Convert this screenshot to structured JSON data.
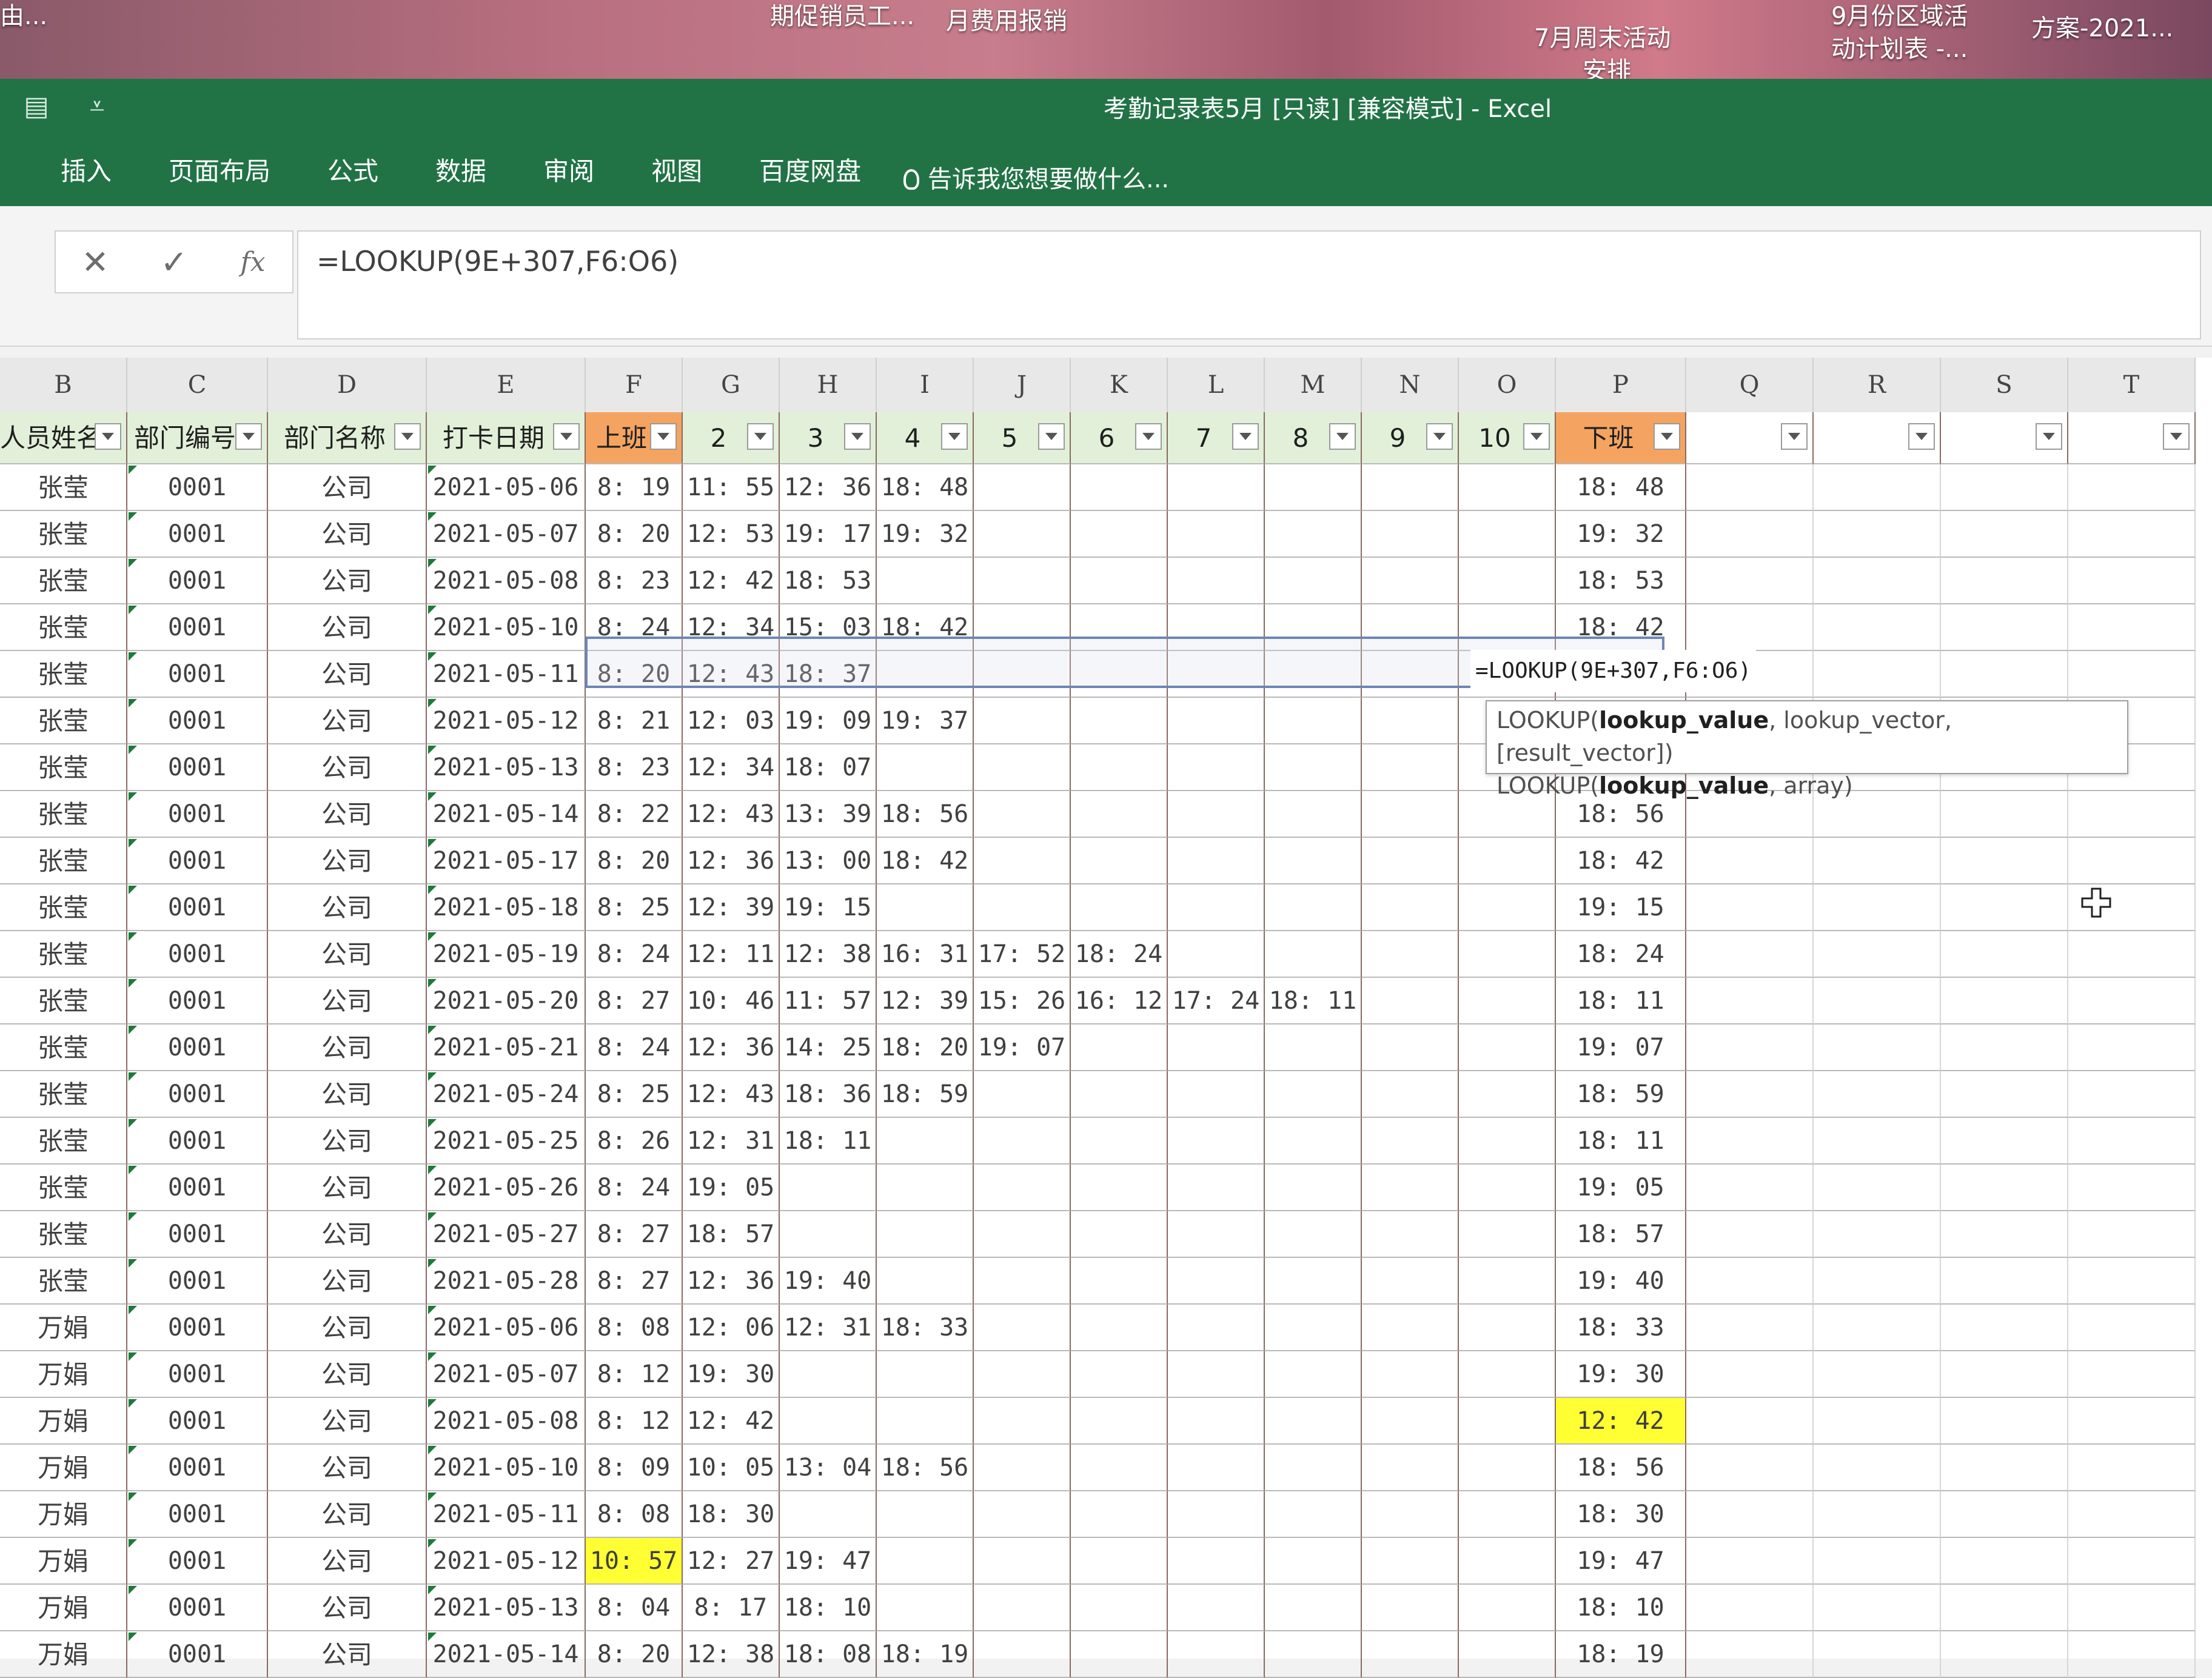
{
  "desktop": {
    "icons": [
      {
        "lines": [
          "由..."
        ]
      },
      {
        "lines": [
          "期促销员工..."
        ]
      },
      {
        "lines": [
          "月费用报销"
        ]
      },
      {
        "lines": [
          "7月周末活动",
          "安排"
        ]
      },
      {
        "lines": [
          "9月份区域活",
          "动计划表 -..."
        ]
      },
      {
        "lines": [
          "方案-2021..."
        ]
      }
    ]
  },
  "window": {
    "title": "考勤记录表5月  [只读]  [兼容模式] - Excel"
  },
  "ribbon": {
    "tabs": [
      "插入",
      "页面布局",
      "公式",
      "数据",
      "审阅",
      "视图",
      "百度网盘"
    ],
    "tell_me": "告诉我您想要做什么..."
  },
  "formula_bar": {
    "cancel": "✕",
    "enter": "✓",
    "fx": "fx",
    "formula": "=LOOKUP(9E+307,F6:O6)"
  },
  "columns": [
    "B",
    "C",
    "D",
    "E",
    "F",
    "G",
    "H",
    "I",
    "J",
    "K",
    "L",
    "M",
    "N",
    "O",
    "P",
    "Q",
    "R",
    "S",
    "T"
  ],
  "headers": [
    "人员姓名",
    "部门编号",
    "部门名称",
    "打卡日期",
    "上班",
    "2",
    "3",
    "4",
    "5",
    "6",
    "7",
    "8",
    "9",
    "10",
    "下班",
    "",
    "",
    "",
    ""
  ],
  "rows": [
    [
      "张莹",
      "0001",
      "公司",
      "2021-05-06",
      "8: 19",
      "11: 55",
      "12: 36",
      "18: 48",
      "",
      "",
      "",
      "",
      "",
      "",
      "18: 48"
    ],
    [
      "张莹",
      "0001",
      "公司",
      "2021-05-07",
      "8: 20",
      "12: 53",
      "19: 17",
      "19: 32",
      "",
      "",
      "",
      "",
      "",
      "",
      "19: 32"
    ],
    [
      "张莹",
      "0001",
      "公司",
      "2021-05-08",
      "8: 23",
      "12: 42",
      "18: 53",
      "",
      "",
      "",
      "",
      "",
      "",
      "",
      "18: 53"
    ],
    [
      "张莹",
      "0001",
      "公司",
      "2021-05-10",
      "8: 24",
      "12: 34",
      "15: 03",
      "18: 42",
      "",
      "",
      "",
      "",
      "",
      "",
      "18: 42"
    ],
    [
      "张莹",
      "0001",
      "公司",
      "2021-05-11",
      "8: 20",
      "12: 43",
      "18: 37",
      "",
      "",
      "",
      "",
      "",
      "",
      "",
      ""
    ],
    [
      "张莹",
      "0001",
      "公司",
      "2021-05-12",
      "8: 21",
      "12: 03",
      "19: 09",
      "19: 37",
      "",
      "",
      "",
      "",
      "",
      "",
      ""
    ],
    [
      "张莹",
      "0001",
      "公司",
      "2021-05-13",
      "8: 23",
      "12: 34",
      "18: 07",
      "",
      "",
      "",
      "",
      "",
      "",
      "",
      ""
    ],
    [
      "张莹",
      "0001",
      "公司",
      "2021-05-14",
      "8: 22",
      "12: 43",
      "13: 39",
      "18: 56",
      "",
      "",
      "",
      "",
      "",
      "",
      "18: 56"
    ],
    [
      "张莹",
      "0001",
      "公司",
      "2021-05-17",
      "8: 20",
      "12: 36",
      "13: 00",
      "18: 42",
      "",
      "",
      "",
      "",
      "",
      "",
      "18: 42"
    ],
    [
      "张莹",
      "0001",
      "公司",
      "2021-05-18",
      "8: 25",
      "12: 39",
      "19: 15",
      "",
      "",
      "",
      "",
      "",
      "",
      "",
      "19: 15"
    ],
    [
      "张莹",
      "0001",
      "公司",
      "2021-05-19",
      "8: 24",
      "12: 11",
      "12: 38",
      "16: 31",
      "17: 52",
      "18: 24",
      "",
      "",
      "",
      "",
      "18: 24"
    ],
    [
      "张莹",
      "0001",
      "公司",
      "2021-05-20",
      "8: 27",
      "10: 46",
      "11: 57",
      "12: 39",
      "15: 26",
      "16: 12",
      "17: 24",
      "18: 11",
      "",
      "",
      "18: 11"
    ],
    [
      "张莹",
      "0001",
      "公司",
      "2021-05-21",
      "8: 24",
      "12: 36",
      "14: 25",
      "18: 20",
      "19: 07",
      "",
      "",
      "",
      "",
      "",
      "19: 07"
    ],
    [
      "张莹",
      "0001",
      "公司",
      "2021-05-24",
      "8: 25",
      "12: 43",
      "18: 36",
      "18: 59",
      "",
      "",
      "",
      "",
      "",
      "",
      "18: 59"
    ],
    [
      "张莹",
      "0001",
      "公司",
      "2021-05-25",
      "8: 26",
      "12: 31",
      "18: 11",
      "",
      "",
      "",
      "",
      "",
      "",
      "",
      "18: 11"
    ],
    [
      "张莹",
      "0001",
      "公司",
      "2021-05-26",
      "8: 24",
      "19: 05",
      "",
      "",
      "",
      "",
      "",
      "",
      "",
      "",
      "19: 05"
    ],
    [
      "张莹",
      "0001",
      "公司",
      "2021-05-27",
      "8: 27",
      "18: 57",
      "",
      "",
      "",
      "",
      "",
      "",
      "",
      "",
      "18: 57"
    ],
    [
      "张莹",
      "0001",
      "公司",
      "2021-05-28",
      "8: 27",
      "12: 36",
      "19: 40",
      "",
      "",
      "",
      "",
      "",
      "",
      "",
      "19: 40"
    ],
    [
      "万娟",
      "0001",
      "公司",
      "2021-05-06",
      "8: 08",
      "12: 06",
      "12: 31",
      "18: 33",
      "",
      "",
      "",
      "",
      "",
      "",
      "18: 33"
    ],
    [
      "万娟",
      "0001",
      "公司",
      "2021-05-07",
      "8: 12",
      "19: 30",
      "",
      "",
      "",
      "",
      "",
      "",
      "",
      "",
      "19: 30"
    ],
    [
      "万娟",
      "0001",
      "公司",
      "2021-05-08",
      "8: 12",
      "12: 42",
      "",
      "",
      "",
      "",
      "",
      "",
      "",
      "",
      "12: 42"
    ],
    [
      "万娟",
      "0001",
      "公司",
      "2021-05-10",
      "8: 09",
      "10: 05",
      "13: 04",
      "18: 56",
      "",
      "",
      "",
      "",
      "",
      "",
      "18: 56"
    ],
    [
      "万娟",
      "0001",
      "公司",
      "2021-05-11",
      "8: 08",
      "18: 30",
      "",
      "",
      "",
      "",
      "",
      "",
      "",
      "",
      "18: 30"
    ],
    [
      "万娟",
      "0001",
      "公司",
      "2021-05-12",
      "10: 57",
      "12: 27",
      "19: 47",
      "",
      "",
      "",
      "",
      "",
      "",
      "",
      "19: 47"
    ],
    [
      "万娟",
      "0001",
      "公司",
      "2021-05-13",
      "8: 04",
      "8: 17",
      "18: 10",
      "",
      "",
      "",
      "",
      "",
      "",
      "",
      "18: 10"
    ],
    [
      "万娟",
      "0001",
      "公司",
      "2021-05-14",
      "8: 20",
      "12: 38",
      "18: 08",
      "18: 19",
      "",
      "",
      "",
      "",
      "",
      "",
      "18: 19"
    ]
  ],
  "editing": {
    "cell_text": "=LOOKUP(9E+307,F6:O6)",
    "tooltip_line1_fn": "LOOKUP(",
    "tooltip_line1_bold": "lookup_value",
    "tooltip_line1_rest": ", lookup_vector, [result_vector])",
    "tooltip_line2_fn": "LOOKUP(",
    "tooltip_line2_bold": "lookup_value",
    "tooltip_line2_rest": ", array)"
  },
  "highlights": {
    "yellow": "#ffff33",
    "header_green": "#e2f0d9",
    "header_orange": "#f4a460",
    "excel_green": "#217346"
  }
}
